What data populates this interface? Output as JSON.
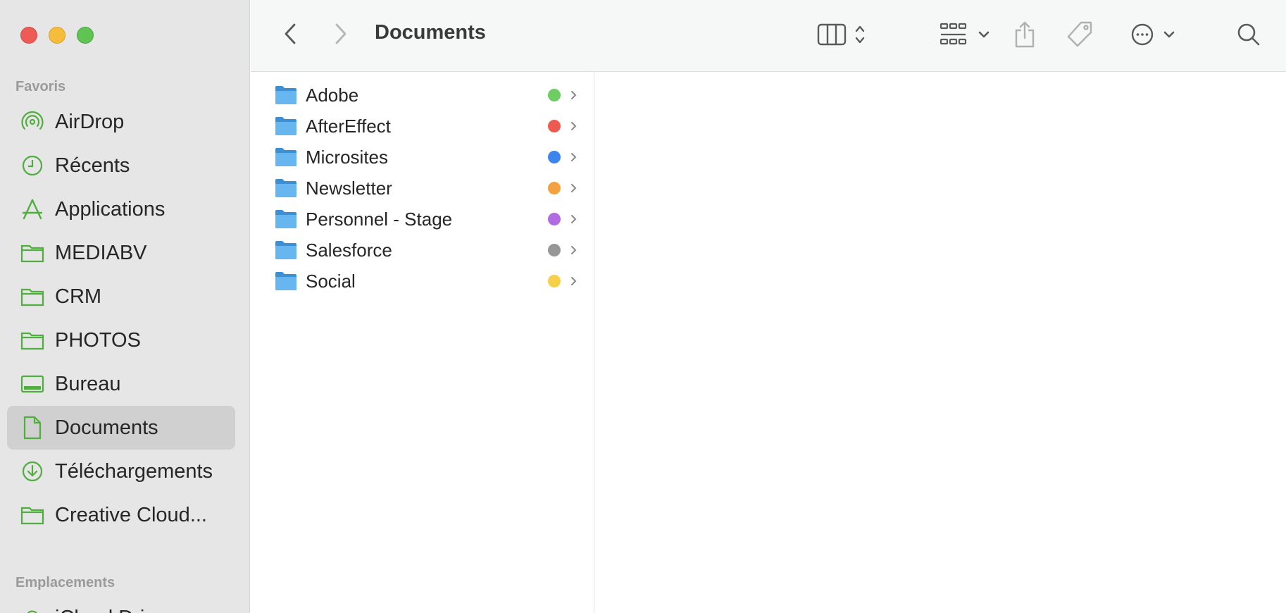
{
  "window": {
    "title": "Documents"
  },
  "sidebar": {
    "favorites_label": "Favoris",
    "locations_label": "Emplacements",
    "locations_partial_item": "iCloud Drive",
    "items": [
      {
        "label": "AirDrop",
        "icon": "airdrop-icon"
      },
      {
        "label": "Récents",
        "icon": "clock-icon"
      },
      {
        "label": "Applications",
        "icon": "applications-icon"
      },
      {
        "label": "MEDIABV",
        "icon": "folder-icon"
      },
      {
        "label": "CRM",
        "icon": "folder-icon"
      },
      {
        "label": "PHOTOS",
        "icon": "folder-icon"
      },
      {
        "label": "Bureau",
        "icon": "desktop-icon"
      },
      {
        "label": "Documents",
        "icon": "document-icon",
        "selected": true
      },
      {
        "label": "Téléchargements",
        "icon": "download-icon"
      },
      {
        "label": "Creative Cloud...",
        "icon": "folder-icon"
      }
    ]
  },
  "files": [
    {
      "name": "Adobe",
      "tag_color": "#6dcd62"
    },
    {
      "name": "AfterEffect",
      "tag_color": "#ec5a50"
    },
    {
      "name": "Microsites",
      "tag_color": "#3c85ee"
    },
    {
      "name": "Newsletter",
      "tag_color": "#f3a241"
    },
    {
      "name": "Personnel - Stage",
      "tag_color": "#b06ce0"
    },
    {
      "name": "Salesforce",
      "tag_color": "#979797"
    },
    {
      "name": "Social",
      "tag_color": "#f7d04a"
    }
  ],
  "colors": {
    "accent_green": "#4fae3f",
    "sidebar_bg": "#e6e6e6",
    "selected_bg": "#d0d0d0",
    "folder_blue": "#5fb1ee"
  }
}
